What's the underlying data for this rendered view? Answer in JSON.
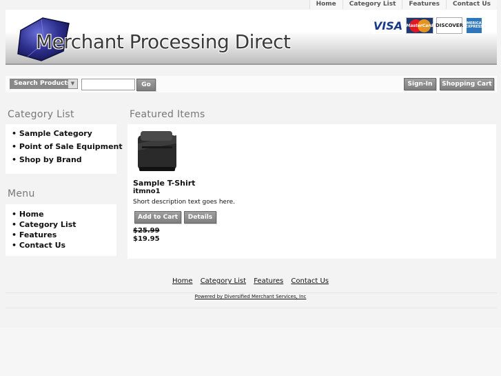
{
  "topnav": {
    "items": [
      "Home",
      "Category List",
      "Features",
      "Contact Us"
    ]
  },
  "header": {
    "site_name": "Merchant Processing Direct",
    "cards": [
      "VISA",
      "MasterCard",
      "DISCOVER",
      "AMERICAN EXPRESS"
    ]
  },
  "search": {
    "category_label": "Search Products",
    "input_value": "",
    "go_label": "Go",
    "signin_label": "Sign-In",
    "cart_label": "Shopping Cart"
  },
  "sidebar": {
    "category_title": "Category List",
    "categories": [
      "• Sample Category",
      "• Point of Sale Equipment",
      "• Shop by Brand"
    ],
    "menu_title": "Menu",
    "menu": [
      "• Home",
      "• Category List",
      "• Features",
      "• Contact Us"
    ]
  },
  "featured": {
    "title": "Featured Items",
    "product": {
      "name": "Sample T-Shirt",
      "sku": "itmno1",
      "description": "Short description text goes here.",
      "add_label": "Add to Cart",
      "details_label": "Details",
      "old_price": "$25.99",
      "price": "$19.95"
    }
  },
  "footer": {
    "links": [
      "Home",
      "Category List",
      "Features",
      "Contact Us"
    ],
    "powered": "Powered by Diversified Merchant Services, Inc"
  },
  "colors": {
    "button": "#888888",
    "heading": "#777777",
    "logo_blue": "#2c2e8c"
  }
}
